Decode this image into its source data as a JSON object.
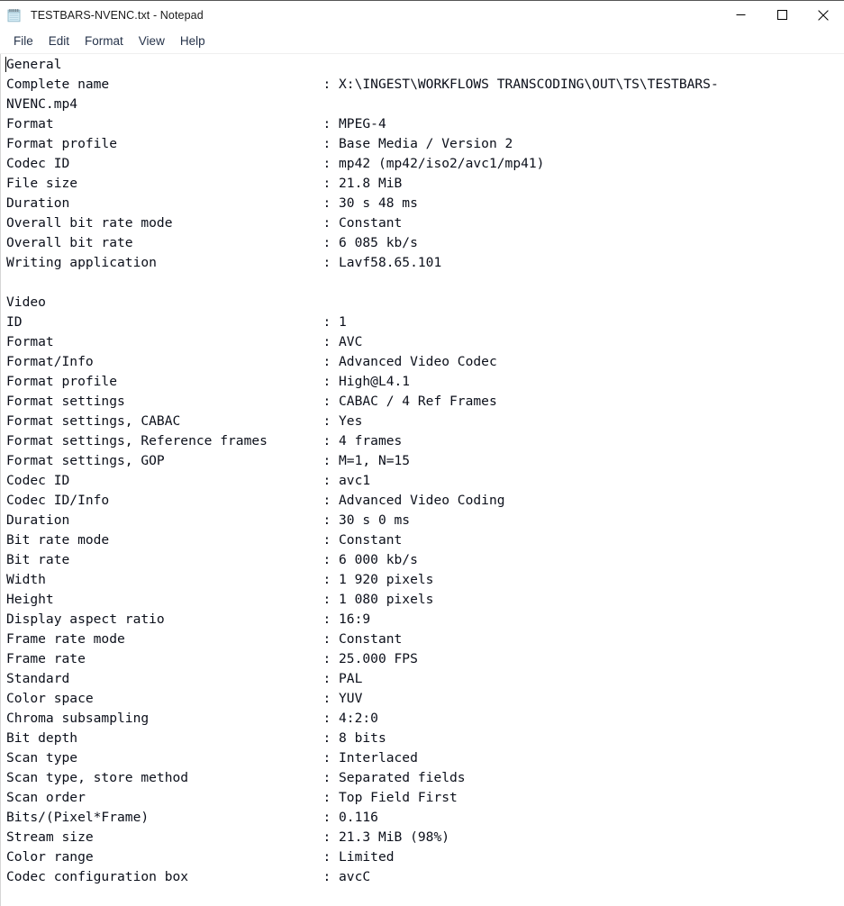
{
  "window": {
    "title": "TESTBARS-NVENC.txt - Notepad",
    "app_icon": "notepad-icon",
    "controls": {
      "minimize": "minimize-icon",
      "maximize": "maximize-icon",
      "close": "close-icon"
    }
  },
  "menubar": {
    "items": [
      {
        "label": "File"
      },
      {
        "label": "Edit"
      },
      {
        "label": "Format"
      },
      {
        "label": "View"
      },
      {
        "label": "Help"
      }
    ]
  },
  "document": {
    "filename": "TESTBARS-NVENC.txt",
    "label_column_width": 40,
    "caret_line": 0,
    "caret_column": 0,
    "lines": [
      {
        "label": "General",
        "value": null
      },
      {
        "label": "Complete name",
        "value": "X:\\INGEST\\WORKFLOWS TRANSCODING\\OUT\\TS\\TESTBARS-"
      },
      {
        "raw": "NVENC.mp4"
      },
      {
        "label": "Format",
        "value": "MPEG-4"
      },
      {
        "label": "Format profile",
        "value": "Base Media / Version 2"
      },
      {
        "label": "Codec ID",
        "value": "mp42 (mp42/iso2/avc1/mp41)"
      },
      {
        "label": "File size",
        "value": "21.8 MiB"
      },
      {
        "label": "Duration",
        "value": "30 s 48 ms"
      },
      {
        "label": "Overall bit rate mode",
        "value": "Constant"
      },
      {
        "label": "Overall bit rate",
        "value": "6 085 kb/s"
      },
      {
        "label": "Writing application",
        "value": "Lavf58.65.101"
      },
      {
        "raw": ""
      },
      {
        "label": "Video",
        "value": null
      },
      {
        "label": "ID",
        "value": "1"
      },
      {
        "label": "Format",
        "value": "AVC"
      },
      {
        "label": "Format/Info",
        "value": "Advanced Video Codec"
      },
      {
        "label": "Format profile",
        "value": "High@L4.1"
      },
      {
        "label": "Format settings",
        "value": "CABAC / 4 Ref Frames"
      },
      {
        "label": "Format settings, CABAC",
        "value": "Yes"
      },
      {
        "label": "Format settings, Reference frames",
        "value": "4 frames"
      },
      {
        "label": "Format settings, GOP",
        "value": "M=1, N=15"
      },
      {
        "label": "Codec ID",
        "value": "avc1"
      },
      {
        "label": "Codec ID/Info",
        "value": "Advanced Video Coding"
      },
      {
        "label": "Duration",
        "value": "30 s 0 ms"
      },
      {
        "label": "Bit rate mode",
        "value": "Constant"
      },
      {
        "label": "Bit rate",
        "value": "6 000 kb/s"
      },
      {
        "label": "Width",
        "value": "1 920 pixels"
      },
      {
        "label": "Height",
        "value": "1 080 pixels"
      },
      {
        "label": "Display aspect ratio",
        "value": "16:9"
      },
      {
        "label": "Frame rate mode",
        "value": "Constant"
      },
      {
        "label": "Frame rate",
        "value": "25.000 FPS"
      },
      {
        "label": "Standard",
        "value": "PAL"
      },
      {
        "label": "Color space",
        "value": "YUV"
      },
      {
        "label": "Chroma subsampling",
        "value": "4:2:0"
      },
      {
        "label": "Bit depth",
        "value": "8 bits"
      },
      {
        "label": "Scan type",
        "value": "Interlaced"
      },
      {
        "label": "Scan type, store method",
        "value": "Separated fields"
      },
      {
        "label": "Scan order",
        "value": "Top Field First"
      },
      {
        "label": "Bits/(Pixel*Frame)",
        "value": "0.116"
      },
      {
        "label": "Stream size",
        "value": "21.3 MiB (98%)"
      },
      {
        "label": "Color range",
        "value": "Limited"
      },
      {
        "label": "Codec configuration box",
        "value": "avcC"
      }
    ]
  },
  "colors": {
    "titlebar_bg": "#ffffff",
    "menu_text": "#26334a",
    "body_text": "#0b0f1a",
    "separator": "#efefef",
    "window_border": "#565656"
  }
}
